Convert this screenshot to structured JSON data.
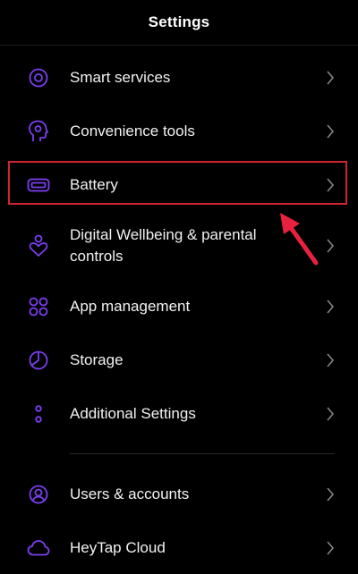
{
  "header": {
    "title": "Settings"
  },
  "colors": {
    "accent": "#7b3ff2",
    "background": "#000000",
    "text": "#f2f2f2",
    "chevron": "#8a8a8a",
    "highlight": "#d0242f"
  },
  "items": [
    {
      "label": "Smart services",
      "icon": "smart-services-icon"
    },
    {
      "label": "Convenience tools",
      "icon": "convenience-tools-icon"
    },
    {
      "label": "Battery",
      "icon": "battery-icon"
    },
    {
      "label": "Digital Wellbeing & parental controls",
      "icon": "digital-wellbeing-icon"
    },
    {
      "label": "App management",
      "icon": "app-management-icon"
    },
    {
      "label": "Storage",
      "icon": "storage-icon"
    },
    {
      "label": "Additional Settings",
      "icon": "additional-settings-icon"
    },
    {
      "label": "Users & accounts",
      "icon": "users-accounts-icon"
    },
    {
      "label": "HeyTap Cloud",
      "icon": "heytap-cloud-icon"
    }
  ]
}
